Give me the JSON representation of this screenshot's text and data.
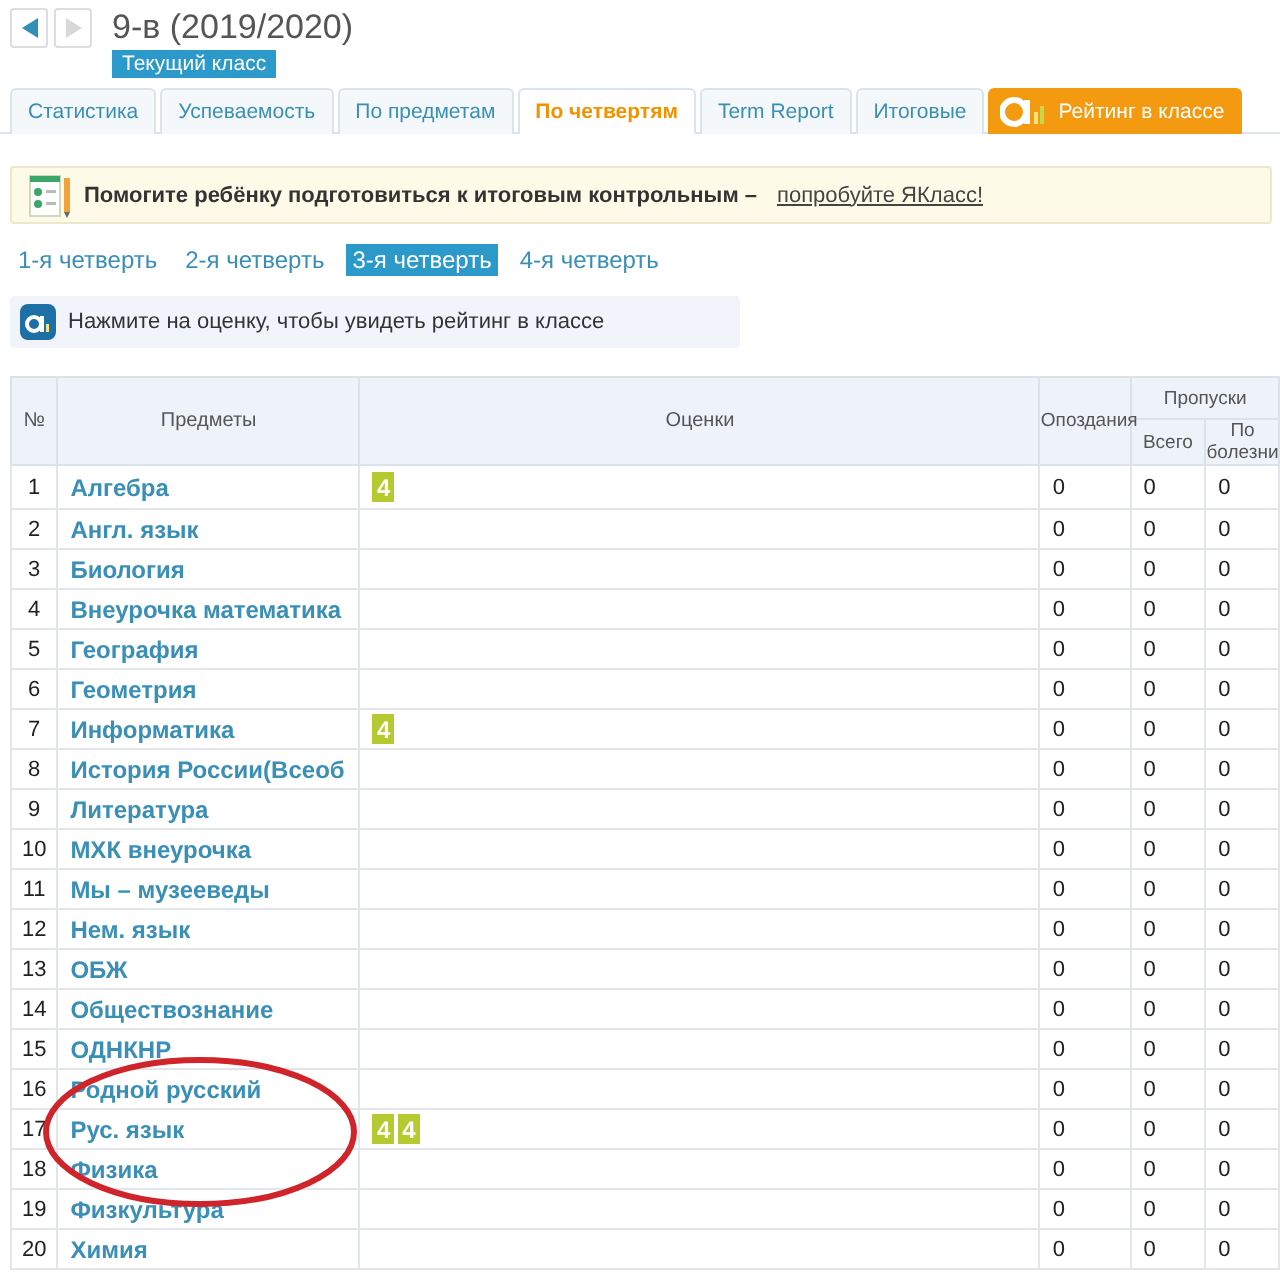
{
  "header": {
    "title": "9-в (2019/2020)",
    "badge": "Текущий класс"
  },
  "tabs": [
    {
      "label": "Статистика",
      "selected": false,
      "kind": "normal"
    },
    {
      "label": "Успеваемость",
      "selected": false,
      "kind": "normal"
    },
    {
      "label": "По предметам",
      "selected": false,
      "kind": "normal"
    },
    {
      "label": "По четвертям",
      "selected": true,
      "kind": "normal"
    },
    {
      "label": "Term Report",
      "selected": false,
      "kind": "normal"
    },
    {
      "label": "Итоговые",
      "selected": false,
      "kind": "normal"
    },
    {
      "label": "Рейтинг в классе",
      "selected": false,
      "kind": "rating"
    }
  ],
  "banner": {
    "text": "Помогите ребёнку подготовиться к итоговым контрольным –",
    "link": "попробуйте ЯКласс!"
  },
  "quarters": [
    {
      "label": "1-я четверть",
      "selected": false
    },
    {
      "label": "2-я четверть",
      "selected": false
    },
    {
      "label": "3-я четверть",
      "selected": true
    },
    {
      "label": "4-я четверть",
      "selected": false
    }
  ],
  "hint": "Нажмите на оценку, чтобы увидеть рейтинг в классе",
  "table": {
    "columns": {
      "number": "№",
      "subject": "Предметы",
      "grades": "Оценки",
      "late": "Опоздания",
      "absences": "Пропуски",
      "absences_total": "Всего",
      "absences_sick": "По болезни"
    },
    "rows": [
      {
        "n": "1",
        "subject": "Алгебра",
        "grades": [
          "4"
        ],
        "late": "0",
        "total": "0",
        "sick": "0"
      },
      {
        "n": "2",
        "subject": "Англ. язык",
        "grades": [],
        "late": "0",
        "total": "0",
        "sick": "0"
      },
      {
        "n": "3",
        "subject": "Биология",
        "grades": [],
        "late": "0",
        "total": "0",
        "sick": "0"
      },
      {
        "n": "4",
        "subject": "Внеурочка математика",
        "grades": [],
        "late": "0",
        "total": "0",
        "sick": "0"
      },
      {
        "n": "5",
        "subject": "География",
        "grades": [],
        "late": "0",
        "total": "0",
        "sick": "0"
      },
      {
        "n": "6",
        "subject": "Геометрия",
        "grades": [],
        "late": "0",
        "total": "0",
        "sick": "0"
      },
      {
        "n": "7",
        "subject": "Информатика",
        "grades": [
          "4"
        ],
        "late": "0",
        "total": "0",
        "sick": "0"
      },
      {
        "n": "8",
        "subject": "История России(Всеоб",
        "grades": [],
        "late": "0",
        "total": "0",
        "sick": "0"
      },
      {
        "n": "9",
        "subject": "Литература",
        "grades": [],
        "late": "0",
        "total": "0",
        "sick": "0"
      },
      {
        "n": "10",
        "subject": "МХК внеурочка",
        "grades": [],
        "late": "0",
        "total": "0",
        "sick": "0"
      },
      {
        "n": "11",
        "subject": "Мы – музееведы",
        "grades": [],
        "late": "0",
        "total": "0",
        "sick": "0"
      },
      {
        "n": "12",
        "subject": "Нем. язык",
        "grades": [],
        "late": "0",
        "total": "0",
        "sick": "0"
      },
      {
        "n": "13",
        "subject": "ОБЖ",
        "grades": [],
        "late": "0",
        "total": "0",
        "sick": "0"
      },
      {
        "n": "14",
        "subject": "Обществознание",
        "grades": [],
        "late": "0",
        "total": "0",
        "sick": "0"
      },
      {
        "n": "15",
        "subject": "ОДНКНР",
        "grades": [],
        "late": "0",
        "total": "0",
        "sick": "0"
      },
      {
        "n": "16",
        "subject": "Родной русский",
        "grades": [],
        "late": "0",
        "total": "0",
        "sick": "0"
      },
      {
        "n": "17",
        "subject": "Рус. язык",
        "grades": [
          "4",
          "4"
        ],
        "late": "0",
        "total": "0",
        "sick": "0"
      },
      {
        "n": "18",
        "subject": "Физика",
        "grades": [],
        "late": "0",
        "total": "0",
        "sick": "0"
      },
      {
        "n": "19",
        "subject": "Физкультура",
        "grades": [],
        "late": "0",
        "total": "0",
        "sick": "0"
      },
      {
        "n": "20",
        "subject": "Химия",
        "grades": [],
        "late": "0",
        "total": "0",
        "sick": "0"
      }
    ]
  }
}
